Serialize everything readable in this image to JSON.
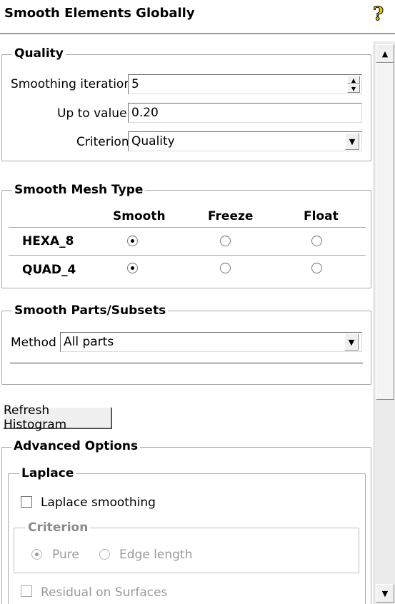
{
  "window": {
    "title": "Smooth Elements Globally",
    "help_icon": "help-question-icon"
  },
  "quality": {
    "title": "Quality",
    "iterations_label": "Smoothing iterations",
    "iterations_value": "5",
    "upto_label": "Up to value",
    "upto_value": "0.20",
    "criterion_label": "Criterion",
    "criterion_value": "Quality"
  },
  "mesh_type": {
    "title": "Smooth Mesh Type",
    "columns": [
      "Smooth",
      "Freeze",
      "Float"
    ],
    "rows": [
      {
        "label": "HEXA_8",
        "selected": "Smooth"
      },
      {
        "label": "QUAD_4",
        "selected": "Smooth"
      }
    ]
  },
  "parts": {
    "title": "Smooth Parts/Subsets",
    "method_label": "Method",
    "method_value": "All parts"
  },
  "refresh_button": "Refresh Histogram",
  "advanced": {
    "title": "Advanced Options",
    "laplace": {
      "title": "Laplace",
      "checkbox_label": "Laplace smoothing",
      "checked": false,
      "criterion_title": "Criterion",
      "options": [
        "Pure",
        "Edge length"
      ],
      "selected": "Pure",
      "residual_label": "Residual on Surfaces"
    }
  }
}
